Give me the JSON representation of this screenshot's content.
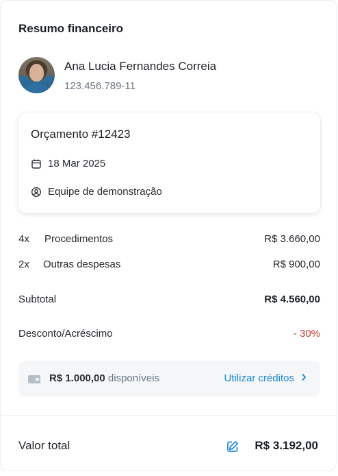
{
  "panel": {
    "title": "Resumo financeiro"
  },
  "client": {
    "name": "Ana Lucia Fernandes Correia",
    "document": "123.456.789-11"
  },
  "quote": {
    "title": "Orçamento #12423",
    "date": "18 Mar 2025",
    "team": "Equipe de demonstração",
    "icons": {
      "date": "calendar-icon",
      "team": "user-circle-icon"
    }
  },
  "items": [
    {
      "qty": "4x",
      "description": "Procedimentos",
      "amount": "R$ 3.660,00"
    },
    {
      "qty": "2x",
      "description": "Outras despesas",
      "amount": "R$ 900,00"
    }
  ],
  "subtotal": {
    "label": "Subtotal",
    "value": "R$ 4.560,00"
  },
  "discount": {
    "label": "Desconto/Acréscimo",
    "value": "- 30%"
  },
  "credits": {
    "amount": "R$ 1.000,00",
    "suffix": "disponíveis",
    "action_label": "Utilizar créditos",
    "icon": "wallet-icon"
  },
  "total": {
    "label": "Valor total",
    "value": "R$ 3.192,00"
  },
  "colors": {
    "accent": "#1a87d6",
    "negative": "#c0392b",
    "muted": "#6b7684"
  }
}
